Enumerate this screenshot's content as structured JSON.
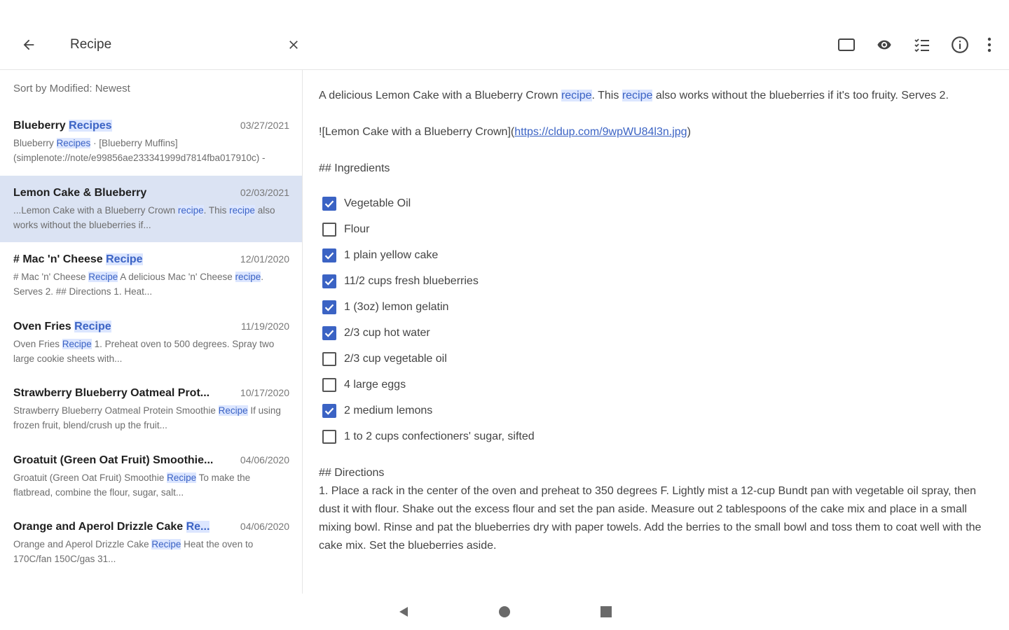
{
  "appbar": {
    "search_value": "Recipe",
    "icons": {
      "back": "arrow-left-icon",
      "clear": "close-icon",
      "actions": [
        "checkbox-square-icon",
        "eye-icon",
        "checklist-icon",
        "info-icon",
        "more-vert-icon"
      ]
    }
  },
  "list": {
    "sort_label": "Sort by Modified: Newest",
    "notes": [
      {
        "title_pre": "Blueberry ",
        "title_hl": "Recipes",
        "title_post": "",
        "date": "03/27/2021",
        "snippet_parts": [
          {
            "t": "Blueberry ",
            "h": false
          },
          {
            "t": "Recipes",
            "h": true
          },
          {
            "t": " · [Blueberry Muffins](simplenote://note/e99856ae233341999d7814fba017910c) - [Lemo...",
            "h": false
          }
        ],
        "selected": false
      },
      {
        "title_pre": "Lemon Cake & Blueberry",
        "title_hl": "",
        "title_post": "",
        "date": "02/03/2021",
        "snippet_parts": [
          {
            "t": "...Lemon Cake with a Blueberry Crown ",
            "h": false
          },
          {
            "t": "recipe",
            "h": true
          },
          {
            "t": ". This ",
            "h": false
          },
          {
            "t": "recipe",
            "h": true
          },
          {
            "t": " also works without the blueberries if...",
            "h": false
          }
        ],
        "selected": true
      },
      {
        "title_pre": "# Mac 'n' Cheese ",
        "title_hl": "Recipe",
        "title_post": "",
        "date": "12/01/2020",
        "snippet_parts": [
          {
            "t": "# Mac 'n' Cheese ",
            "h": false
          },
          {
            "t": "Recipe",
            "h": true
          },
          {
            "t": "  A delicious Mac 'n' Cheese ",
            "h": false
          },
          {
            "t": "recipe",
            "h": true
          },
          {
            "t": ". Serves 2.  ## Directions 1. Heat...",
            "h": false
          }
        ],
        "selected": false
      },
      {
        "title_pre": "Oven Fries ",
        "title_hl": "Recipe",
        "title_post": "",
        "date": "11/19/2020",
        "snippet_parts": [
          {
            "t": "Oven Fries ",
            "h": false
          },
          {
            "t": "Recipe",
            "h": true
          },
          {
            "t": "  1. Preheat oven to 500 degrees. Spray two large cookie sheets with...",
            "h": false
          }
        ],
        "selected": false
      },
      {
        "title_pre": "Strawberry Blueberry Oatmeal Prot...",
        "title_hl": "",
        "title_post": "",
        "date": "10/17/2020",
        "snippet_parts": [
          {
            "t": "Strawberry Blueberry Oatmeal Protein Smoothie ",
            "h": false
          },
          {
            "t": "Recipe",
            "h": true
          },
          {
            "t": "  If using frozen fruit, blend/crush up the fruit...",
            "h": false
          }
        ],
        "selected": false
      },
      {
        "title_pre": "Groatuit (Green Oat Fruit) Smoothie...",
        "title_hl": "",
        "title_post": "",
        "date": "04/06/2020",
        "snippet_parts": [
          {
            "t": "Groatuit (Green Oat Fruit) Smoothie ",
            "h": false
          },
          {
            "t": "Recipe",
            "h": true
          },
          {
            "t": "  To make the flatbread, combine the flour, sugar, salt...",
            "h": false
          }
        ],
        "selected": false
      },
      {
        "title_pre": "Orange and Aperol Drizzle Cake ",
        "title_hl": "Re...",
        "title_post": "",
        "date": "04/06/2020",
        "snippet_parts": [
          {
            "t": "Orange and Aperol Drizzle Cake ",
            "h": false
          },
          {
            "t": "Recipe",
            "h": true
          },
          {
            "t": "  Heat the oven to 170C/fan 150C/gas 31...",
            "h": false
          }
        ],
        "selected": false
      }
    ]
  },
  "editor": {
    "intro_parts": [
      {
        "t": "A delicious Lemon Cake with a Blueberry Crown ",
        "h": false
      },
      {
        "t": "recipe",
        "h": true
      },
      {
        "t": ". This ",
        "h": false
      },
      {
        "t": "recipe",
        "h": true
      },
      {
        "t": " also works without the blueberries if it's too fruity. Serves 2.",
        "h": false
      }
    ],
    "image_prefix": "![Lemon Cake with a Blueberry Crown](",
    "image_url": "https://cldup.com/9wpWU84l3n.jpg",
    "image_suffix": ")",
    "ingredients_heading": "## Ingredients",
    "checklist": [
      {
        "label": "Vegetable Oil",
        "checked": true
      },
      {
        "label": "Flour",
        "checked": false
      },
      {
        "label": "1 plain yellow cake",
        "checked": true
      },
      {
        "label": "11/2 cups fresh blueberries",
        "checked": true
      },
      {
        "label": "1 (3oz) lemon gelatin",
        "checked": true
      },
      {
        "label": "2/3 cup hot water",
        "checked": true
      },
      {
        "label": "2/3 cup vegetable oil",
        "checked": false
      },
      {
        "label": "4 large eggs",
        "checked": false
      },
      {
        "label": "2 medium lemons",
        "checked": true
      },
      {
        "label": "1 to 2 cups confectioners' sugar, sifted",
        "checked": false
      }
    ],
    "directions_heading": "## Directions",
    "directions_text": "1. Place a rack in the center of the oven and preheat to 350 degrees F. Lightly mist a 12-cup Bundt pan with vegetable oil spray, then dust it with flour. Shake out the excess flour and set the pan aside. Measure out 2 tablespoons of the cake mix and place in a small mixing bowl. Rinse and pat the blueberries dry with paper towels. Add the berries to the small bowl and toss them to coat well with the cake mix. Set the blueberries aside."
  },
  "sysnav": {
    "icons": [
      "nav-back-triangle-icon",
      "nav-home-circle-icon",
      "nav-recents-square-icon"
    ]
  },
  "colors": {
    "accent": "#3b63c4",
    "highlight_bg": "#dce6ff",
    "selected_row": "#dbe3f3"
  }
}
